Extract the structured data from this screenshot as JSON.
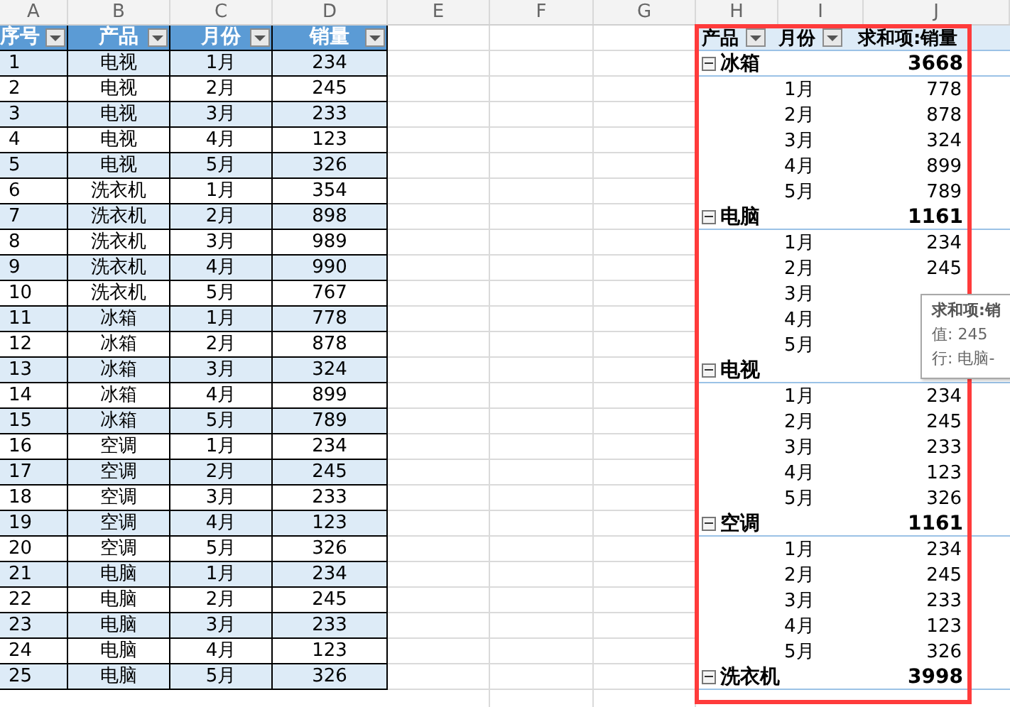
{
  "column_headers": [
    "A",
    "B",
    "C",
    "D",
    "E",
    "F",
    "G",
    "H",
    "I",
    "J"
  ],
  "table": {
    "columns": [
      "序号",
      "产品",
      "月份",
      "销量"
    ],
    "rows": [
      [
        "1",
        "电视",
        "1月",
        "234"
      ],
      [
        "2",
        "电视",
        "2月",
        "245"
      ],
      [
        "3",
        "电视",
        "3月",
        "233"
      ],
      [
        "4",
        "电视",
        "4月",
        "123"
      ],
      [
        "5",
        "电视",
        "5月",
        "326"
      ],
      [
        "6",
        "洗衣机",
        "1月",
        "354"
      ],
      [
        "7",
        "洗衣机",
        "2月",
        "898"
      ],
      [
        "8",
        "洗衣机",
        "3月",
        "989"
      ],
      [
        "9",
        "洗衣机",
        "4月",
        "990"
      ],
      [
        "10",
        "洗衣机",
        "5月",
        "767"
      ],
      [
        "11",
        "冰箱",
        "1月",
        "778"
      ],
      [
        "12",
        "冰箱",
        "2月",
        "878"
      ],
      [
        "13",
        "冰箱",
        "3月",
        "324"
      ],
      [
        "14",
        "冰箱",
        "4月",
        "899"
      ],
      [
        "15",
        "冰箱",
        "5月",
        "789"
      ],
      [
        "16",
        "空调",
        "1月",
        "234"
      ],
      [
        "17",
        "空调",
        "2月",
        "245"
      ],
      [
        "18",
        "空调",
        "3月",
        "233"
      ],
      [
        "19",
        "空调",
        "4月",
        "123"
      ],
      [
        "20",
        "空调",
        "5月",
        "326"
      ],
      [
        "21",
        "电脑",
        "1月",
        "234"
      ],
      [
        "22",
        "电脑",
        "2月",
        "245"
      ],
      [
        "23",
        "电脑",
        "3月",
        "233"
      ],
      [
        "24",
        "电脑",
        "4月",
        "123"
      ],
      [
        "25",
        "电脑",
        "5月",
        "326"
      ]
    ]
  },
  "pivot": {
    "headers": [
      {
        "label": "产品",
        "filter": true
      },
      {
        "label": "月份",
        "filter": true
      },
      {
        "label": "求和项:销量",
        "filter": false
      }
    ],
    "groups": [
      {
        "name": "冰箱",
        "total": "3668",
        "expanded": true,
        "rows": [
          {
            "label": "1月",
            "value": "778"
          },
          {
            "label": "2月",
            "value": "878"
          },
          {
            "label": "3月",
            "value": "324"
          },
          {
            "label": "4月",
            "value": "899"
          },
          {
            "label": "5月",
            "value": "789"
          }
        ]
      },
      {
        "name": "电脑",
        "total": "1161",
        "expanded": true,
        "rows": [
          {
            "label": "1月",
            "value": "234"
          },
          {
            "label": "2月",
            "value": "245"
          },
          {
            "label": "3月"
          },
          {
            "label": "4月"
          },
          {
            "label": "5月"
          }
        ]
      },
      {
        "name": "电视",
        "expanded": true,
        "rows": [
          {
            "label": "1月",
            "value": "234"
          },
          {
            "label": "2月",
            "value": "245"
          },
          {
            "label": "3月",
            "value": "233"
          },
          {
            "label": "4月",
            "value": "123"
          },
          {
            "label": "5月",
            "value": "326"
          }
        ]
      },
      {
        "name": "空调",
        "total": "1161",
        "expanded": true,
        "rows": [
          {
            "label": "1月",
            "value": "234"
          },
          {
            "label": "2月",
            "value": "245"
          },
          {
            "label": "3月",
            "value": "233"
          },
          {
            "label": "4月",
            "value": "123"
          },
          {
            "label": "5月",
            "value": "326"
          }
        ]
      },
      {
        "name": "洗衣机",
        "total": "3998",
        "expanded": true
      }
    ]
  },
  "tooltip": {
    "title": "求和项:销",
    "value": "值: 245",
    "row": "行: 电脑-"
  }
}
